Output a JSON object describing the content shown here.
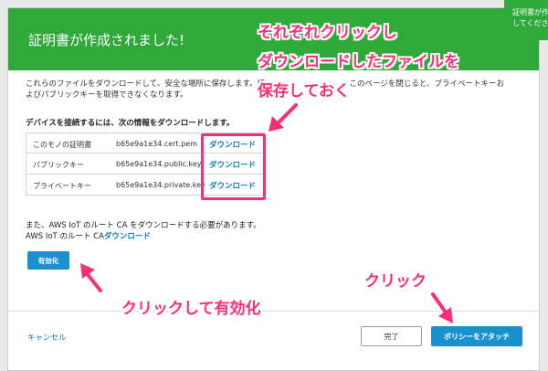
{
  "dialog": {
    "title": "証明書が作成されました!",
    "corner_toast": {
      "line1": "証明書が作成",
      "line2": "してください"
    },
    "intro_line1": "これらのファイルをダウンロードして、安全な場所に保存します。証",
    "intro_line1_tail": "、このページを閉じると、プライベートキーお",
    "intro_line2": "よびパブリックキーを取得できなくなります。",
    "section_heading": "デバイスを接続するには、次の情報をダウンロードします。",
    "files": [
      {
        "label": "このモノの証明書",
        "filename": "b65e9a1e34.cert.pem",
        "action": "ダウンロード"
      },
      {
        "label": "パブリックキー",
        "filename": "b65e9a1e34.public.key",
        "action": "ダウンロード"
      },
      {
        "label": "プライベートキー",
        "filename": "b65e9a1e34.private.key",
        "action": "ダウンロード"
      }
    ],
    "ca_note": "また、AWS IoT のルート CA をダウンロードする必要があります。",
    "ca_prefix": "AWS IoT のルート CA",
    "ca_link": "ダウンロード",
    "activate_label": "有効化",
    "cancel_label": "キャンセル",
    "done_label": "完了",
    "attach_policy_label": "ポリシーをアタッチ"
  },
  "annotations": {
    "download_note": [
      "それぞれクリックし",
      "ダウンロードしたファイルを",
      "保存しておく"
    ],
    "activate_note": "クリックして有効化",
    "policy_note": "クリック",
    "accent_color": "#ff2d78"
  },
  "colors": {
    "header": "#2fa939",
    "primary": "#1b90cf",
    "link": "#0f79c0"
  }
}
